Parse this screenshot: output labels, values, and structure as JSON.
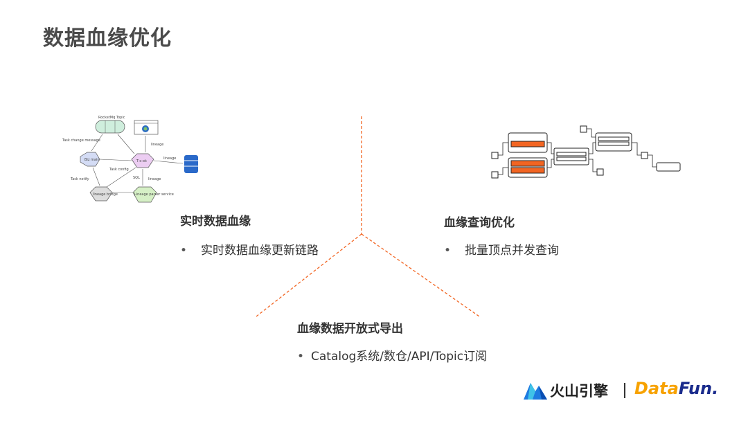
{
  "page": {
    "title": "数据血缘优化"
  },
  "sections": [
    {
      "title": "实时数据血缘",
      "bullet": "实时数据血缘更新链路"
    },
    {
      "title": "血缘查询优化",
      "bullet": "批量顶点并发查询"
    },
    {
      "title": "血缘数据开放式导出",
      "bullet": "Catalog系统/数仓/API/Topic订阅"
    }
  ],
  "bullet_symbol": "•",
  "diagram1": {
    "nodes": {
      "topic": "RocketMq Topic",
      "svc_main": "Biz main",
      "center": "T-s-ok",
      "bridge": "lineage bridge",
      "parser": "Lineage parser service"
    },
    "edges": {
      "e1": "Task change message",
      "e2": "lineage",
      "e3": "lineage",
      "e4": "Task config",
      "e5": "Task notify",
      "e6": "SQL",
      "e7": "lineage"
    }
  },
  "logos": {
    "volcano": "火山引擎",
    "datafun_a": "Data",
    "datafun_b": "Fun."
  },
  "colors": {
    "accent": "#f26522",
    "divider": "#f26522",
    "title": "#4a4a4a"
  }
}
